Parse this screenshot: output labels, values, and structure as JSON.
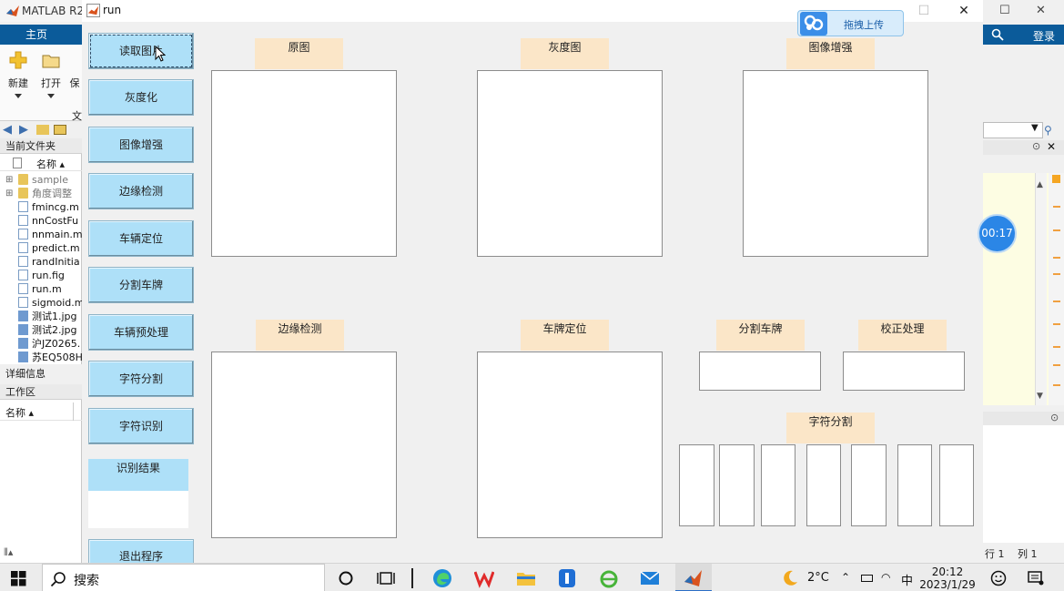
{
  "matlab": {
    "title": "MATLAB R2",
    "home_tab": "主页",
    "ribbon": {
      "new_label": "新建",
      "open_label": "打开",
      "save_label": "保",
      "file_label": "文"
    },
    "current_folder_label": "当前文件夹",
    "name_col": "名称 ▴",
    "files": [
      "sample",
      "角度调整",
      "fmincg.m",
      "nnCostFu",
      "nnmain.m",
      "predict.m",
      "randInitia",
      "run.fig",
      "run.m",
      "sigmoid.m",
      "测试1.jpg",
      "测试2.jpg",
      "沪JZ0265.",
      "苏EQ508H"
    ],
    "details_label": "详细信息",
    "workspace_label": "工作区",
    "ws_name_col": "名称 ▴",
    "login_label": "登录",
    "status_row": "行 1",
    "status_col": "列 1"
  },
  "run_window": {
    "title": "run",
    "minimize": "—",
    "maximize": "☐",
    "close": "✕"
  },
  "buttons": {
    "read_image": "读取图片",
    "grayscale": "灰度化",
    "enhance": "图像增强",
    "edge_detect": "边缘检测",
    "locate_vehicle": "车辆定位",
    "split_plate": "分割车牌",
    "preprocess": "车辆预处理",
    "char_segment": "字符分割",
    "char_recognize": "字符识别",
    "exit": "退出程序"
  },
  "result": {
    "title": "识别结果",
    "value": ""
  },
  "panels": {
    "original": "原图",
    "grayscale": "灰度图",
    "enhanced": "图像增强",
    "edge": "边缘检测",
    "plate_locate": "车牌定位",
    "split_plate": "分割车牌",
    "correction": "校正处理",
    "char_segment": "字符分割"
  },
  "upload_widget": {
    "label": "拖拽上传"
  },
  "timer": {
    "value": "00:17"
  },
  "taskbar": {
    "search_placeholder": "搜索",
    "temperature": "2°C",
    "ime": "中",
    "time": "20:12",
    "date": "2023/1/29"
  },
  "colors": {
    "button_bg": "#aee0f8",
    "panel_title_bg": "#fbe6c8",
    "matlab_blue": "#0b5b9a",
    "timer_blue": "#2b86e6"
  }
}
